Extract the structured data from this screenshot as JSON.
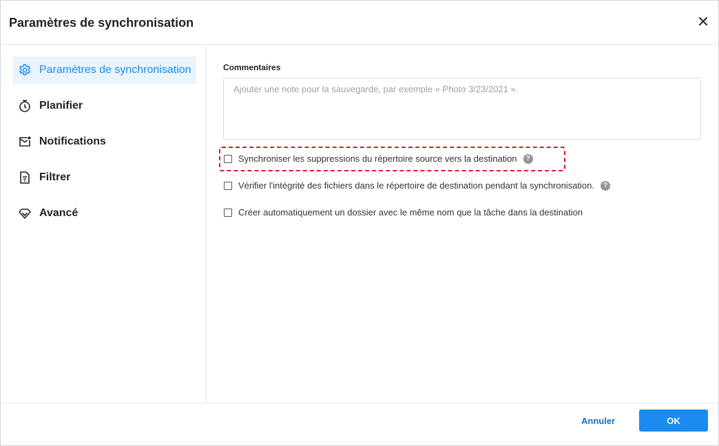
{
  "dialog": {
    "title": "Paramètres de synchronisation"
  },
  "sidebar": {
    "items": [
      {
        "label": "Paramètres de synchronisation",
        "icon": "gear-icon",
        "active": true
      },
      {
        "label": "Planifier",
        "icon": "stopwatch-icon",
        "active": false
      },
      {
        "label": "Notifications",
        "icon": "mail-notification-icon",
        "active": false
      },
      {
        "label": "Filtrer",
        "icon": "document-filter-icon",
        "active": false
      },
      {
        "label": "Avancé",
        "icon": "diamond-icon",
        "active": false
      }
    ]
  },
  "main": {
    "comments_label": "Commentaires",
    "comments_placeholder": "Ajouter une note pour la sauvegarde, par exemple « Photo 3/23/2021 ».",
    "comments_value": "",
    "options": [
      {
        "label": "Synchroniser les suppressions du répertoire source vers la destination",
        "checked": false,
        "help": true
      },
      {
        "label": "Vérifier l'intégrité des fichiers dans le répertoire de destination pendant la synchronisation.",
        "checked": false,
        "help": true
      },
      {
        "label": "Créer automatiquement un dossier avec le même nom que la tâche dans la destination",
        "checked": false,
        "help": false
      }
    ],
    "help_symbol": "?"
  },
  "footer": {
    "cancel_label": "Annuler",
    "ok_label": "OK"
  },
  "colors": {
    "accent": "#1a8cf0",
    "active_bg": "#eaf4fd",
    "highlight": "#d8191c"
  }
}
